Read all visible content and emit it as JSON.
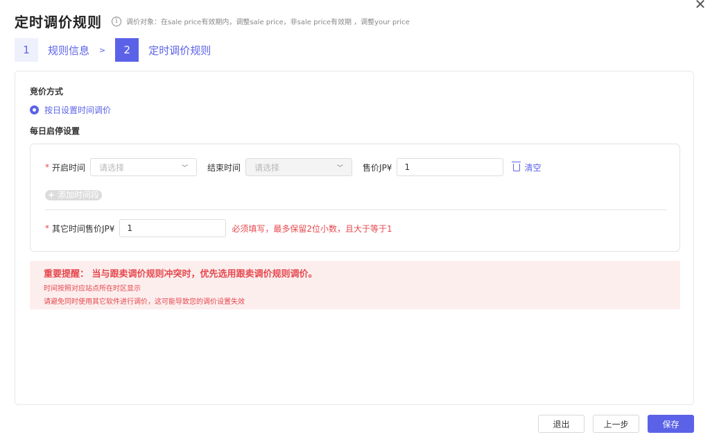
{
  "header": {
    "title": "定时调价规则",
    "note": "调价对象：在sale price有效期内，调整sale price，非sale price有效期 ，调整your price",
    "close_symbol": "✕"
  },
  "steps": [
    {
      "num": "1",
      "label": "规则信息"
    },
    {
      "num": "2",
      "label": "定时调价规则"
    }
  ],
  "step_separator": ">",
  "form": {
    "bidding_method_title": "竞价方式",
    "bidding_option": "按日设置时间调价",
    "daily_title": "每日启停设置",
    "start_time_label": "开启时间",
    "start_time_placeholder": "请选择",
    "end_time_label": "结束时间",
    "end_time_placeholder": "请选择",
    "price_label": "售价JP¥",
    "price_value": "1",
    "clear_label": "清空",
    "add_period_label": "添加时间段",
    "other_price_label": "其它时间售价JP¥",
    "other_price_value": "1",
    "other_price_error": "必须填写，最多保留2位小数，且大于等于1",
    "required_mark": "*"
  },
  "notice": {
    "title": "重要提醒： 当与跟卖调价规则冲突时，优先选用跟卖调价规则调价。",
    "line1": "时间按照对应站点所在时区显示",
    "line2": "请避免同时使用其它软件进行调价，这可能导致您的调价设置失效"
  },
  "footer": {
    "exit_label": "退出",
    "prev_label": "上一步",
    "save_label": "保存"
  },
  "colors": {
    "primary": "#5b62e8",
    "error": "#e5484d",
    "notice_bg": "#fdeeee"
  }
}
